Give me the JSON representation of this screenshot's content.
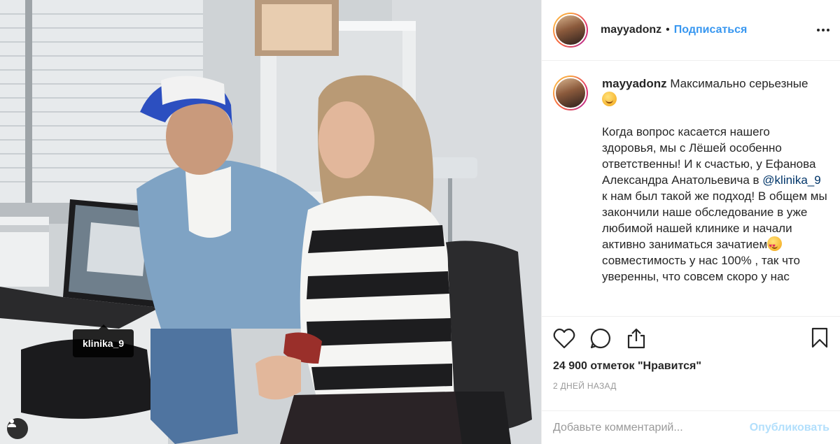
{
  "photo": {
    "tag_label": "klinika_9",
    "icons": {
      "tags": "user-tag-icon"
    }
  },
  "header": {
    "username": "mayyadonz",
    "separator": "•",
    "follow_label": "Подписаться",
    "icons": {
      "more": "ellipsis-icon"
    }
  },
  "caption": {
    "username": "mayyadonz",
    "title": "Максимально серьезные",
    "text_1": "Когда вопрос касается нашего здоровья, мы с Лёшей особенно ответственны! И к счастью, у Ефанова Александра Анатольевича в",
    "mention": "@klinika_9",
    "text_2": "к нам был такой же подход! В общем мы закончили наше обследование в уже любимой нашей клинике и начали активно заниматься зачатием",
    "text_3": "совместимость у нас 100% , так что уверенны, что совсем скоро у нас"
  },
  "actions": {
    "likes": "24 900 отметок \"Нравится\"",
    "timestamp": "2 дней назад",
    "icons": {
      "like": "heart-icon",
      "comment": "comment-icon",
      "share": "share-icon",
      "save": "bookmark-icon"
    }
  },
  "comment_box": {
    "placeholder": "Добавьте комментарий...",
    "publish_label": "Опубликовать"
  },
  "colors": {
    "link": "#3897f0",
    "mention": "#003569",
    "publish_disabled": "#b2dffc",
    "muted": "#999999",
    "border": "#efefef"
  }
}
